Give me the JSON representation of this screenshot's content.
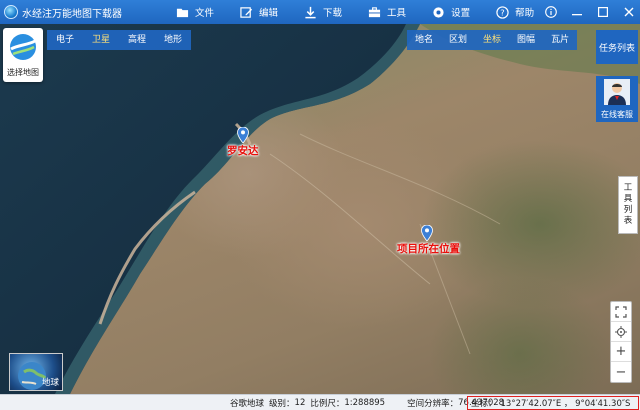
{
  "app": {
    "title": "水经注万能地图下载器"
  },
  "menu": {
    "file": "文件",
    "edit": "编辑",
    "download": "下载",
    "tools": "工具",
    "settings": "设置",
    "help": "帮助"
  },
  "map_type_tabs": [
    {
      "label": "电子",
      "active": false
    },
    {
      "label": "卫星",
      "active": true
    },
    {
      "label": "高程",
      "active": false
    },
    {
      "label": "地形",
      "active": false
    }
  ],
  "overlay_tabs": [
    {
      "label": "地名",
      "active": false
    },
    {
      "label": "区划",
      "active": false
    },
    {
      "label": "坐标",
      "active": true
    },
    {
      "label": "图幅",
      "active": false
    },
    {
      "label": "瓦片",
      "active": false
    }
  ],
  "choose_map": {
    "label": "选择地图"
  },
  "right_panel": {
    "task_list": "任务列表",
    "online_service": "在线客服",
    "tools_list": [
      "工",
      "具",
      "列",
      "表"
    ]
  },
  "map_controls": {
    "zoom_in": "+",
    "zoom_out": "−"
  },
  "markers": [
    {
      "label": "罗安达"
    },
    {
      "label": "项目所在位置"
    }
  ],
  "earth_thumb": {
    "label": "地球"
  },
  "status": {
    "source": "谷歌地球",
    "level_label": "级别：",
    "level_value": "12",
    "scale_label": "比例尺：",
    "scale_value": "1:288895",
    "resolution_label": "空间分辨率：",
    "resolution_value": "76.437028",
    "coord_label": "坐标：",
    "coord_value": "13°27′42.07″E ， 9°04′41.30″S"
  },
  "colors": {
    "accent": "#1f66c0",
    "active_tab_text": "#ffe27a",
    "marker_label": "#e8100c",
    "marker_pin": "#3b7fd6",
    "coord_border": "#e02020"
  }
}
